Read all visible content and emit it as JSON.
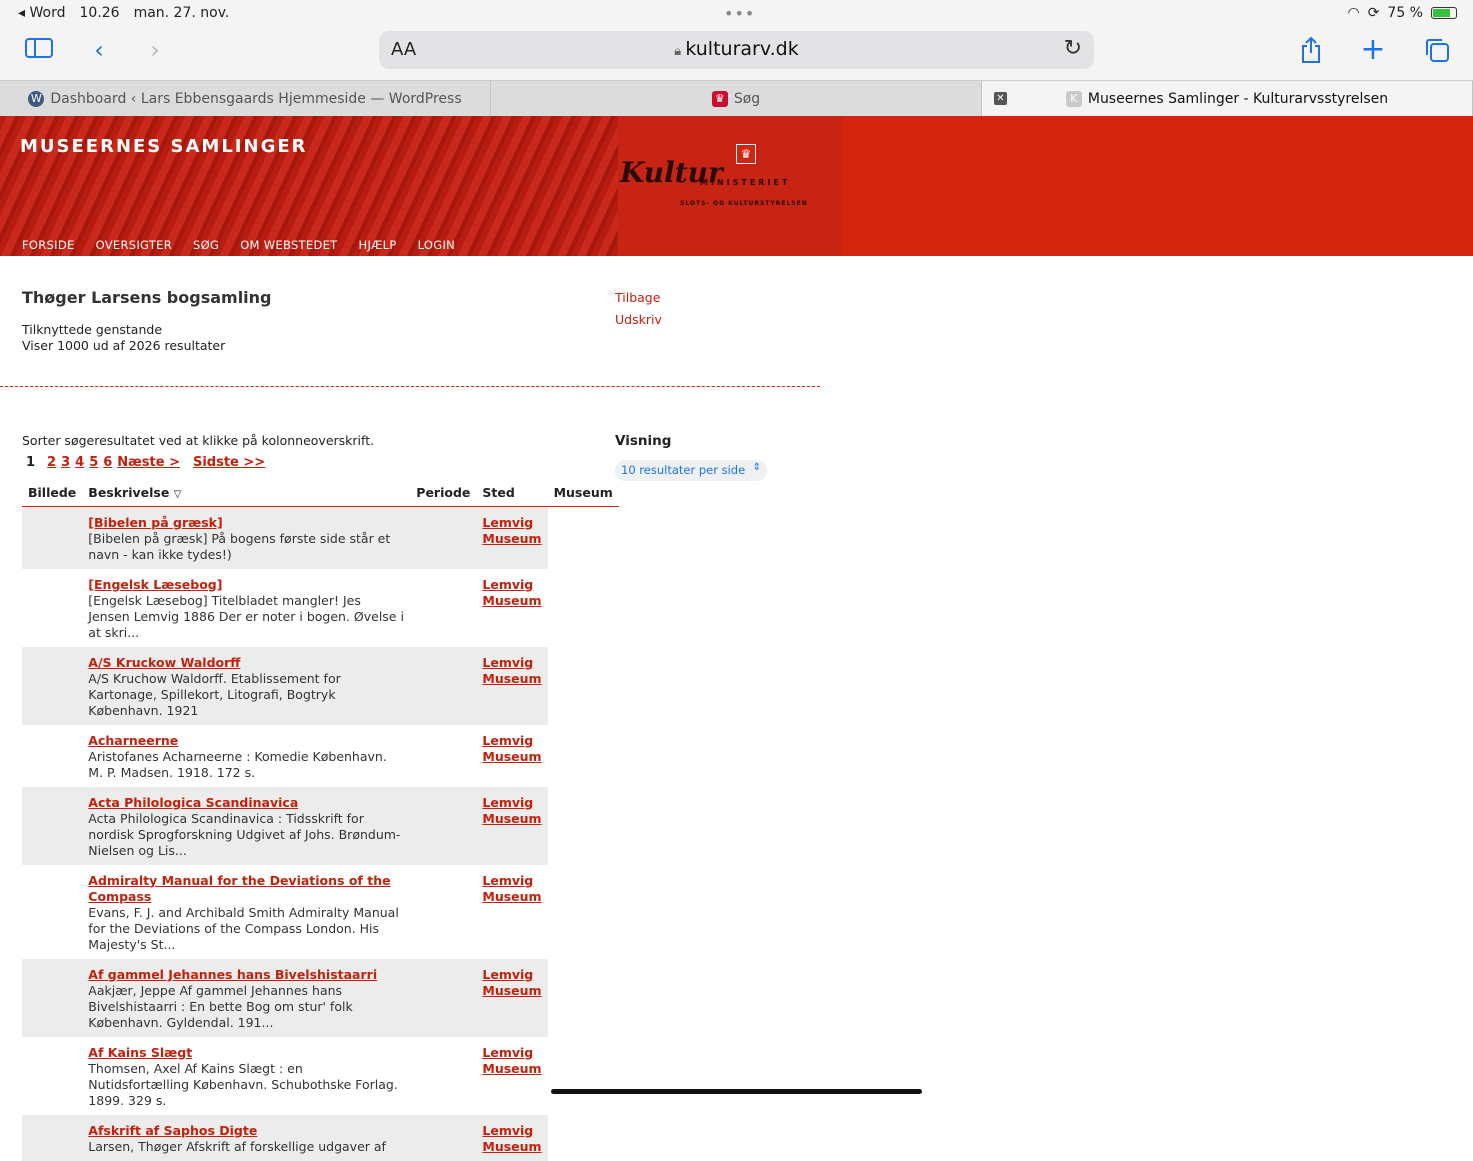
{
  "status": {
    "back_app": "Word",
    "time": "10.26",
    "date": "man. 27. nov.",
    "battery": "75 %",
    "battery_level": 0.75
  },
  "toolbar": {
    "aa": "AA",
    "url": "kulturarv.dk"
  },
  "tabs": [
    {
      "label": "Dashboard ‹ Lars Ebbensgaards Hjemmeside — WordPress"
    },
    {
      "label": "Søg"
    },
    {
      "label": "Museernes Samlinger - Kulturarvsstyrelsen"
    }
  ],
  "header": {
    "brand": "MUSEERNES SAMLINGER",
    "logo_text": "Kultur",
    "logo_sub": "MINISTERIET",
    "logo_sub2": "SLOTS- OG KULTURSTYRELSEN",
    "nav": [
      "FORSIDE",
      "OVERSIGTER",
      "SØG",
      "OM WEBSTEDET",
      "HJÆLP",
      "LOGIN"
    ]
  },
  "page": {
    "title": "Thøger Larsens bogsamling",
    "subtitle1": "Tilknyttede genstande",
    "subtitle2": "Viser 1000 ud af 2026 resultater",
    "back_link": "Tilbage",
    "print_link": "Udskriv",
    "sort_hint": "Sorter søgeresultatet ved at klikke på kolonneoverskrift."
  },
  "pager": {
    "current": "1",
    "pages": [
      "2",
      "3",
      "4",
      "5",
      "6"
    ],
    "next": "Næste >",
    "last": "Sidste >>"
  },
  "visning": {
    "title": "Visning",
    "selected": "10 resultater per side"
  },
  "table": {
    "headers": {
      "image": "Billede",
      "desc": "Beskrivelse",
      "period": "Periode",
      "place": "Sted",
      "museum": "Museum"
    },
    "rows": [
      {
        "title": "[Bibelen på græsk]",
        "desc": "[Bibelen på græsk] På bogens første side står et navn - kan ikke tydes!)",
        "place1": "Lemvig",
        "place2": "Museum"
      },
      {
        "title": "[Engelsk Læsebog]",
        "desc": "[Engelsk Læsebog] Titelbladet mangler! Jes Jensen Lemvig 1886 Der er noter i bogen. Øvelse i at skri...",
        "place1": "Lemvig",
        "place2": "Museum"
      },
      {
        "title": "A/S Kruckow Waldorff",
        "desc": "A/S Kruchow Waldorff. Etablissement for Kartonage, Spillekort, Litografi, Bogtryk København. 1921",
        "place1": "Lemvig",
        "place2": "Museum"
      },
      {
        "title": "Acharneerne",
        "desc": "Aristofanes Acharneerne : Komedie København. M. P. Madsen. 1918. 172 s.",
        "place1": "Lemvig",
        "place2": "Museum"
      },
      {
        "title": "Acta Philologica Scandinavica",
        "desc": "Acta Philologica Scandinavica : Tidsskrift for nordisk Sprogforskning Udgivet af Johs. Brøndum-Nielsen og Lis...",
        "place1": "Lemvig",
        "place2": "Museum"
      },
      {
        "title": "Admiralty Manual for the Deviations of the Compass",
        "desc": "Evans, F. J. and Archibald Smith Admiralty Manual for the Deviations of the Compass London. His Majesty's St...",
        "place1": "Lemvig",
        "place2": "Museum"
      },
      {
        "title": "Af gammel Jehannes hans Bivelshistaarri",
        "desc": "Aakjær, Jeppe Af gammel Jehannes hans Bivelshistaarri : En bette Bog om stur' folk København. Gyldendal. 191...",
        "place1": "Lemvig",
        "place2": "Museum"
      },
      {
        "title": "Af Kains Slægt",
        "desc": "Thomsen, Axel Af Kains Slægt : en Nutidsfortælling København. Schubothske Forlag. 1899. 329 s.",
        "place1": "Lemvig",
        "place2": "Museum"
      },
      {
        "title": "Afskrift af Saphos Digte",
        "desc": "Larsen, Thøger Afskrift af forskellige udgaver af",
        "place1": "Lemvig",
        "place2": "Museum"
      }
    ]
  }
}
